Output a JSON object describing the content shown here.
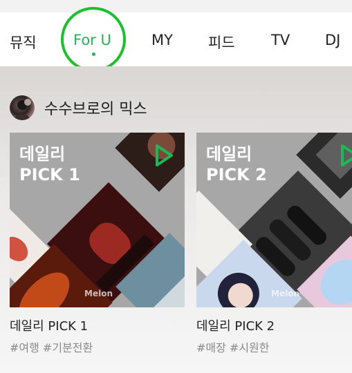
{
  "tabs": [
    {
      "label": "뮤직",
      "active": false
    },
    {
      "label": "For U",
      "active": true
    },
    {
      "label": "MY",
      "active": false
    },
    {
      "label": "피드",
      "active": false
    },
    {
      "label": "TV",
      "active": false
    },
    {
      "label": "DJ",
      "active": false
    }
  ],
  "section": {
    "title": "수수브로의 믹스"
  },
  "cards": [
    {
      "cover_title": "데일리\nPICK 1",
      "brand": "Melon",
      "name": "데일리 PICK 1",
      "tags": "#여행 #기분전환"
    },
    {
      "cover_title": "데일리\nPICK 2",
      "brand": "Melon",
      "name": "데일리 PICK 2",
      "tags": "#매장 #시원한"
    }
  ],
  "colors": {
    "accent": "#1db954",
    "highlight_ring": "#19c12d",
    "cover_gray": "#a7a7a7"
  },
  "icons": {
    "play": "play-icon"
  }
}
